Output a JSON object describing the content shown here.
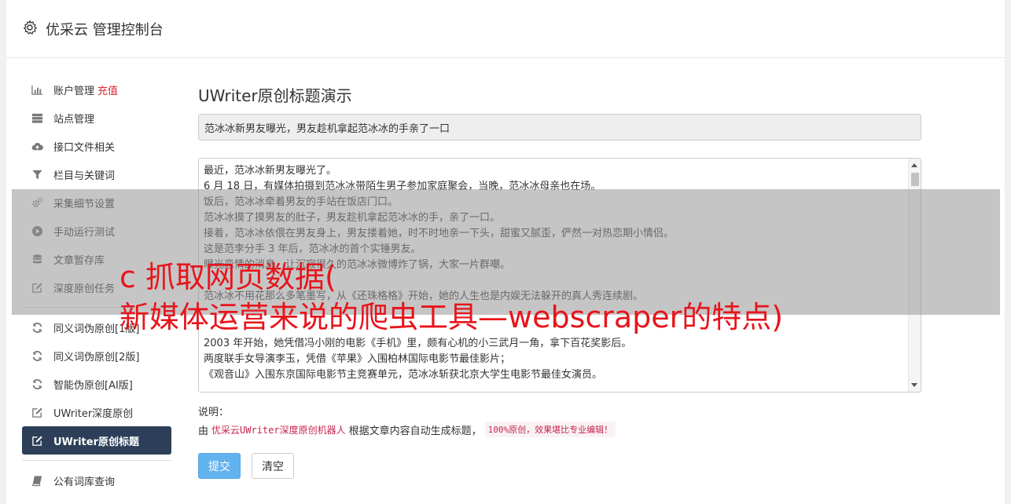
{
  "header": {
    "title": "优采云 管理控制台"
  },
  "sidebar": {
    "items": [
      {
        "label": "账户管理",
        "badge": "充值",
        "icon": "bar-chart-icon"
      },
      {
        "label": "站点管理",
        "icon": "server-icon"
      },
      {
        "label": "接口文件相关",
        "icon": "cloud-upload-icon"
      },
      {
        "label": "栏目与关键词",
        "icon": "filter-icon"
      },
      {
        "label": "采集细节设置",
        "icon": "gears-icon"
      },
      {
        "label": "手动运行测试",
        "icon": "play-circle-icon"
      },
      {
        "label": "文章暂存库",
        "icon": "database-icon"
      },
      {
        "label": "深度原创任务",
        "icon": "edit-icon"
      },
      {
        "label": "同义词伪原创[1版]",
        "icon": "refresh-icon"
      },
      {
        "label": "同义词伪原创[2版]",
        "icon": "refresh-icon"
      },
      {
        "label": "智能伪原创[AI版]",
        "icon": "refresh-icon"
      },
      {
        "label": "UWriter深度原创",
        "icon": "edit-icon"
      },
      {
        "label": "UWriter原创标题",
        "icon": "edit-icon",
        "active": true
      },
      {
        "label": "公有词库查询",
        "icon": "book-icon"
      }
    ]
  },
  "main": {
    "title": "UWriter原创标题演示",
    "title_input": "范冰冰新男友曝光，男友趁机拿起范冰冰的手亲了一口",
    "content_lines": [
      "最近，范冰冰新男友曝光了。",
      "6 月 18 日，有媒体拍摄到范冰冰带陌生男子参加家庭聚会，当晚，范冰冰母亲也在场。",
      "饭后，范冰冰牵着男友的手站在饭店门口。",
      "范冰冰摸了摸男友的肚子，男友趁机拿起范冰冰的手，亲了一口。",
      "接着，范冰冰依偎在男友身上，男友搂着她，时不时地亲一下头，甜蜜又腻歪，俨然一对热恋期小情侣。",
      "这是范李分手 3 年后，范冰冰的首个实锤男友。",
      "曝光恋情的消息，让沉寂很久的范冰冰微博炸了锅，大家一片群嘲。",
      "",
      "范冰冰不用花那么多笔墨写，从《还珠格格》开始，她的人生也是内娱无法躲开的真人秀连续剧。",
      "",
      "",
      "2003 年开始，她凭借冯小刚的电影《手机》里，颇有心机的小三武月一角，拿下百花奖影后。",
      "两度联手女导演李玉，凭借《苹果》入围柏林国际电影节最佳影片；",
      "《观音山》入围东京国际电影节主竞赛单元，范冰冰斩获北京大学生电影节最佳女演员。"
    ],
    "note_label": "说明：",
    "note_prefix": "由",
    "note_code": "优采云UWriter深度原创机器人",
    "note_middle": "根据文章内容自动生成标题，",
    "note_highlight": "100%原创，效果堪比专业编辑！",
    "submit_label": "提交",
    "clear_label": "清空"
  },
  "overlay": {
    "line1": "c 抓取网页数据(",
    "line2": "新媒体运营来说的爬虫工具—webscraper的特点)"
  },
  "colors": {
    "accent_active": "#2d3e58",
    "badge_red": "#d9252f",
    "submit_blue": "#62b2f0",
    "overlay_text": "#e8141b"
  }
}
